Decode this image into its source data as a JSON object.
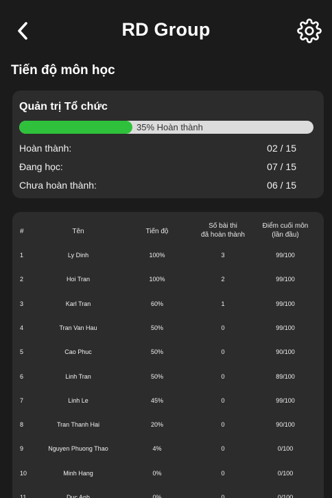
{
  "header": {
    "title": "RD Group"
  },
  "section_title": "Tiến độ môn học",
  "course": {
    "name": "Quản trị Tổ chức",
    "progress_percent": 35,
    "progress_label": "35% Hoàn thành",
    "stats": [
      {
        "label": "Hoàn thành:",
        "value": "02 / 15"
      },
      {
        "label": "Đang học:",
        "value": "07 / 15"
      },
      {
        "label": "Chưa hoàn thành:",
        "value": "06 / 15"
      }
    ]
  },
  "table": {
    "headers": {
      "index": "#",
      "name": "Tên",
      "progress": "Tiến độ",
      "tests_line1": "Số bài thi",
      "tests_line2": "đã hoàn thành",
      "score_line1": "Điểm cuối môn",
      "score_line2": "(lần đầu)"
    },
    "rows": [
      {
        "idx": "1",
        "name": "Ly Dinh",
        "progress": "100%",
        "tests": "3",
        "score": "99/100"
      },
      {
        "idx": "2",
        "name": "Hoi Tran",
        "progress": "100%",
        "tests": "2",
        "score": "99/100"
      },
      {
        "idx": "3",
        "name": "Karl Tran",
        "progress": "60%",
        "tests": "1",
        "score": "99/100"
      },
      {
        "idx": "4",
        "name": "Tran Van Hau",
        "progress": "50%",
        "tests": "0",
        "score": "99/100"
      },
      {
        "idx": "5",
        "name": "Cao Phuc",
        "progress": "50%",
        "tests": "0",
        "score": "90/100"
      },
      {
        "idx": "6",
        "name": "Linh Tran",
        "progress": "50%",
        "tests": "0",
        "score": "89/100"
      },
      {
        "idx": "7",
        "name": "Linh Le",
        "progress": "45%",
        "tests": "0",
        "score": "99/100"
      },
      {
        "idx": "8",
        "name": "Tran Thanh Hai",
        "progress": "20%",
        "tests": "0",
        "score": "90/100"
      },
      {
        "idx": "9",
        "name": "Nguyen Phuong Thao",
        "progress": "4%",
        "tests": "0",
        "score": "0/100"
      },
      {
        "idx": "10",
        "name": "Minh Hang",
        "progress": "0%",
        "tests": "0",
        "score": "0/100"
      },
      {
        "idx": "11",
        "name": "Duc Anh",
        "progress": "0%",
        "tests": "0",
        "score": "0/100"
      }
    ]
  },
  "icons": {
    "back": "chevron-left-icon",
    "settings": "gear-icon"
  },
  "colors": {
    "background": "#1b1b1b",
    "card": "#2c2c2c",
    "progress_fill": "#2fc13b",
    "progress_track": "#dcdcdc"
  }
}
